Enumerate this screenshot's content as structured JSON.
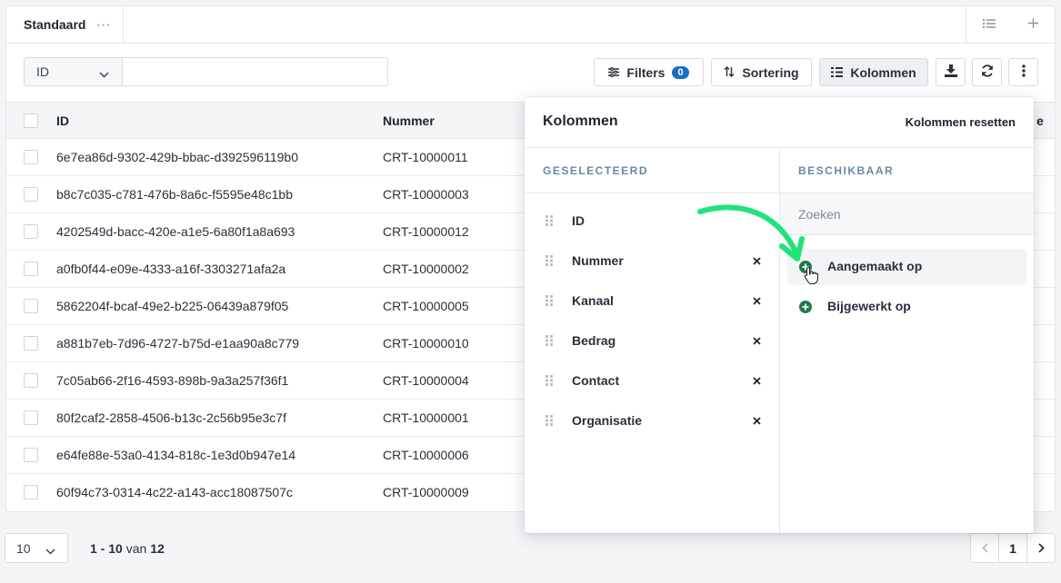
{
  "tabbar": {
    "tab_label": "Standaard",
    "tab_more": "···"
  },
  "toolbar": {
    "filter_field": "ID",
    "filters_label": "Filters",
    "filters_count": "0",
    "sort_label": "Sortering",
    "columns_label": "Kolommen"
  },
  "table": {
    "headers": {
      "id": "ID",
      "number": "Nummer",
      "last": "e"
    },
    "rows": [
      {
        "id": "6e7ea86d-9302-429b-bbac-d392596119b0",
        "number": "CRT-10000011"
      },
      {
        "id": "b8c7c035-c781-476b-8a6c-f5595e48c1bb",
        "number": "CRT-10000003"
      },
      {
        "id": "4202549d-bacc-420e-a1e5-6a80f1a8a693",
        "number": "CRT-10000012"
      },
      {
        "id": "a0fb0f44-e09e-4333-a16f-3303271afa2a",
        "number": "CRT-10000002"
      },
      {
        "id": "5862204f-bcaf-49e2-b225-06439a879f05",
        "number": "CRT-10000005"
      },
      {
        "id": "a881b7eb-7d96-4727-b75d-e1aa90a8c779",
        "number": "CRT-10000010"
      },
      {
        "id": "7c05ab66-2f16-4593-898b-9a3a257f36f1",
        "number": "CRT-10000004"
      },
      {
        "id": "80f2caf2-2858-4506-b13c-2c56b95e3c7f",
        "number": "CRT-10000001"
      },
      {
        "id": "e64fe88e-53a0-4134-818c-1e3d0b947e14",
        "number": "CRT-10000006"
      },
      {
        "id": "60f94c73-0314-4c22-a143-acc18087507c",
        "number": "CRT-10000009"
      }
    ]
  },
  "footer": {
    "page_size": "10",
    "range_start": "1",
    "range_sep": " - ",
    "range_end": "10",
    "range_of": " van ",
    "total": "12",
    "current_page": "1"
  },
  "columns_popover": {
    "title": "Kolommen",
    "reset_label": "Kolommen resetten",
    "selected_heading": "GESELECTEERD",
    "available_heading": "BESCHIKBAAR",
    "search_placeholder": "Zoeken",
    "selected": [
      "ID",
      "Nummer",
      "Kanaal",
      "Bedrag",
      "Contact",
      "Organisatie"
    ],
    "available": [
      "Aangemaakt op",
      "Bijgewerkt op"
    ]
  },
  "colors": {
    "accent": "#1a6fc1",
    "add_green": "#1e7a4c",
    "arrow_green": "#22e37a"
  },
  "icons": {
    "grip": "drag-handle-icon",
    "remove": "close-icon",
    "add": "plus-circle-icon",
    "filter": "sliders-icon",
    "sort": "sort-arrows-icon",
    "columns": "columns-icon",
    "download": "download-icon",
    "refresh": "refresh-icon",
    "more": "kebab-icon"
  }
}
